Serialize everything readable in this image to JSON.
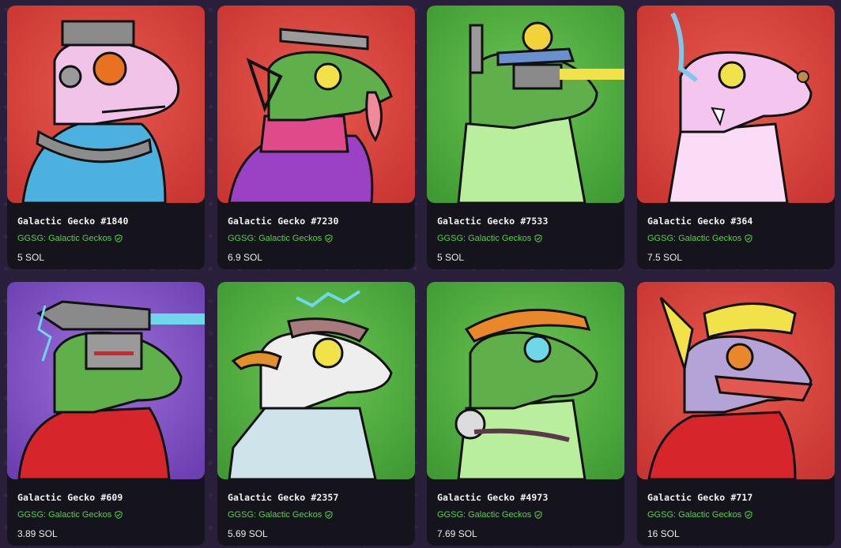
{
  "cards": [
    {
      "name": "Galactic Gecko #1840",
      "collection": "GGSG: Galactic Geckos",
      "price": "5 SOL",
      "bg": "red",
      "skin": "#f1c3e9"
    },
    {
      "name": "Galactic Gecko #7230",
      "collection": "GGSG: Galactic Geckos",
      "price": "6.9 SOL",
      "bg": "red",
      "skin": "#5fb04a"
    },
    {
      "name": "Galactic Gecko #7533",
      "collection": "GGSG: Galactic Geckos",
      "price": "5 SOL",
      "bg": "green",
      "skin": "#5fb04a"
    },
    {
      "name": "Galactic Gecko #364",
      "collection": "GGSG: Galactic Geckos",
      "price": "7.5 SOL",
      "bg": "red",
      "skin": "#f4c6ef"
    },
    {
      "name": "Galactic Gecko #609",
      "collection": "GGSG: Galactic Geckos",
      "price": "3.89 SOL",
      "bg": "purple",
      "skin": "#5fb04a"
    },
    {
      "name": "Galactic Gecko #2357",
      "collection": "GGSG: Galactic Geckos",
      "price": "5.69 SOL",
      "bg": "green",
      "skin": "#eeeeee"
    },
    {
      "name": "Galactic Gecko #4973",
      "collection": "GGSG: Galactic Geckos",
      "price": "7.69 SOL",
      "bg": "green",
      "skin": "#5fb04a"
    },
    {
      "name": "Galactic Gecko #717",
      "collection": "GGSG: Galactic Geckos",
      "price": "16 SOL",
      "bg": "red",
      "skin": "#b3a3d6"
    }
  ],
  "colors": {
    "collection_text": "#57d14a",
    "card_bg": "#15131c",
    "page_bg": "#2a1f3a",
    "bg_red": "#d8423f",
    "bg_green": "#4fae3e",
    "bg_purple": "#8a5cc8"
  },
  "icons": {
    "verified": "verified-badge-icon"
  }
}
